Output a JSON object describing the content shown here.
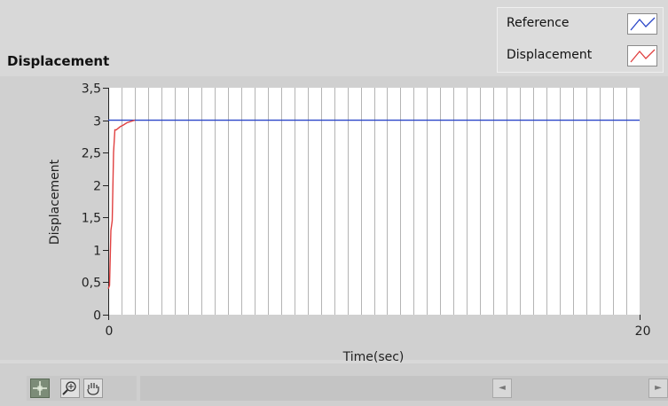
{
  "graph": {
    "title": "Displacement",
    "xlabel": "Time(sec)",
    "ylabel": "Displacement"
  },
  "legend": {
    "items": [
      {
        "label": "Reference",
        "color": "#2a46c8"
      },
      {
        "label": "Displacement",
        "color": "#e04040"
      }
    ]
  },
  "chart_data": {
    "type": "line",
    "title": "Displacement",
    "xlabel": "Time(sec)",
    "ylabel": "Displacement",
    "xlim": [
      0,
      20
    ],
    "ylim": [
      0,
      3.5
    ],
    "x_ticks": [
      "0",
      "20"
    ],
    "y_ticks": [
      "0",
      "0,5",
      "1",
      "1,5",
      "2",
      "2,5",
      "3",
      "3,5"
    ],
    "grid": "vertical",
    "legend_position": "top-right",
    "series": [
      {
        "name": "Reference",
        "color": "#2a46c8",
        "x": [
          0,
          20
        ],
        "y": [
          3,
          3
        ]
      },
      {
        "name": "Displacement",
        "color": "#e04040",
        "x": [
          0,
          0.05,
          0.1,
          0.15,
          0.2,
          0.25,
          0.3,
          0.45,
          0.55,
          0.7,
          0.85,
          1.0
        ],
        "y": [
          0.4,
          0.45,
          1.3,
          1.45,
          2.5,
          2.85,
          2.85,
          2.9,
          2.92,
          2.96,
          2.98,
          3.0
        ]
      }
    ]
  },
  "toolbar": {
    "tools": [
      {
        "name": "cursor-move-icon"
      },
      {
        "name": "zoom-icon"
      },
      {
        "name": "pan-hand-icon"
      }
    ],
    "scroll_left_glyph": "◄",
    "scroll_right_glyph": "►"
  }
}
